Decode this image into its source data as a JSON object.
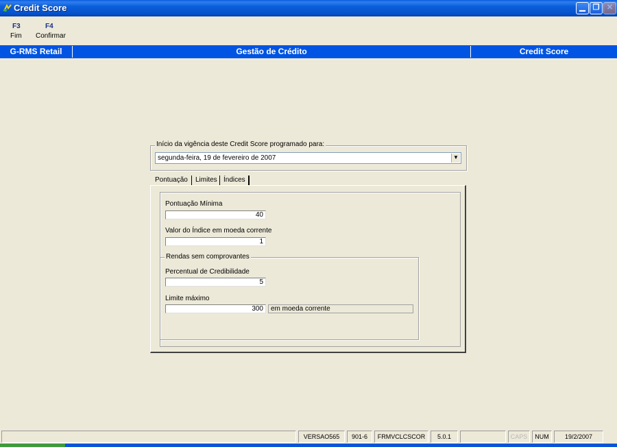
{
  "window": {
    "title": "Credit Score",
    "controls": [
      "minimize-icon",
      "restore-icon",
      "close-icon"
    ]
  },
  "function_keys": [
    {
      "key": "F3",
      "label": "Fim"
    },
    {
      "key": "F4",
      "label": "Confirmar"
    }
  ],
  "header": {
    "left": "G-RMS Retail",
    "center": "Gestão de Crédito",
    "right": "Credit Score"
  },
  "vigencia": {
    "legend": "Início da vigência deste Credit Score programado para:",
    "date_value": "segunda-feira, 19 de  fevereiro  de 2007"
  },
  "tabs": [
    {
      "label": "Pontuação",
      "active": false
    },
    {
      "label": "Limites",
      "active": false
    },
    {
      "label": "Índices",
      "active": true
    }
  ],
  "indices": {
    "pontuacao_minima_label": "Pontuação Mínima",
    "pontuacao_minima_value": "40",
    "valor_indice_label": "Valor do Índice em moeda corrente",
    "valor_indice_value": "1",
    "rendas_legend": "Rendas sem comprovantes",
    "percentual_label": "Percentual de Credibilidade",
    "percentual_value": "5",
    "limite_label": "Limite máximo",
    "limite_value": "300",
    "limite_unit": "em moeda corrente"
  },
  "statusbar": {
    "cells": [
      "",
      "VERSAO565",
      "901-6",
      "FRMVCLCSCOR",
      "5.0.1",
      "",
      "CAPS",
      "NUM",
      "19/2/2007"
    ]
  },
  "colors": {
    "titlebar": "#0054e3",
    "header": "#0054e3",
    "background": "#ece9d8"
  }
}
